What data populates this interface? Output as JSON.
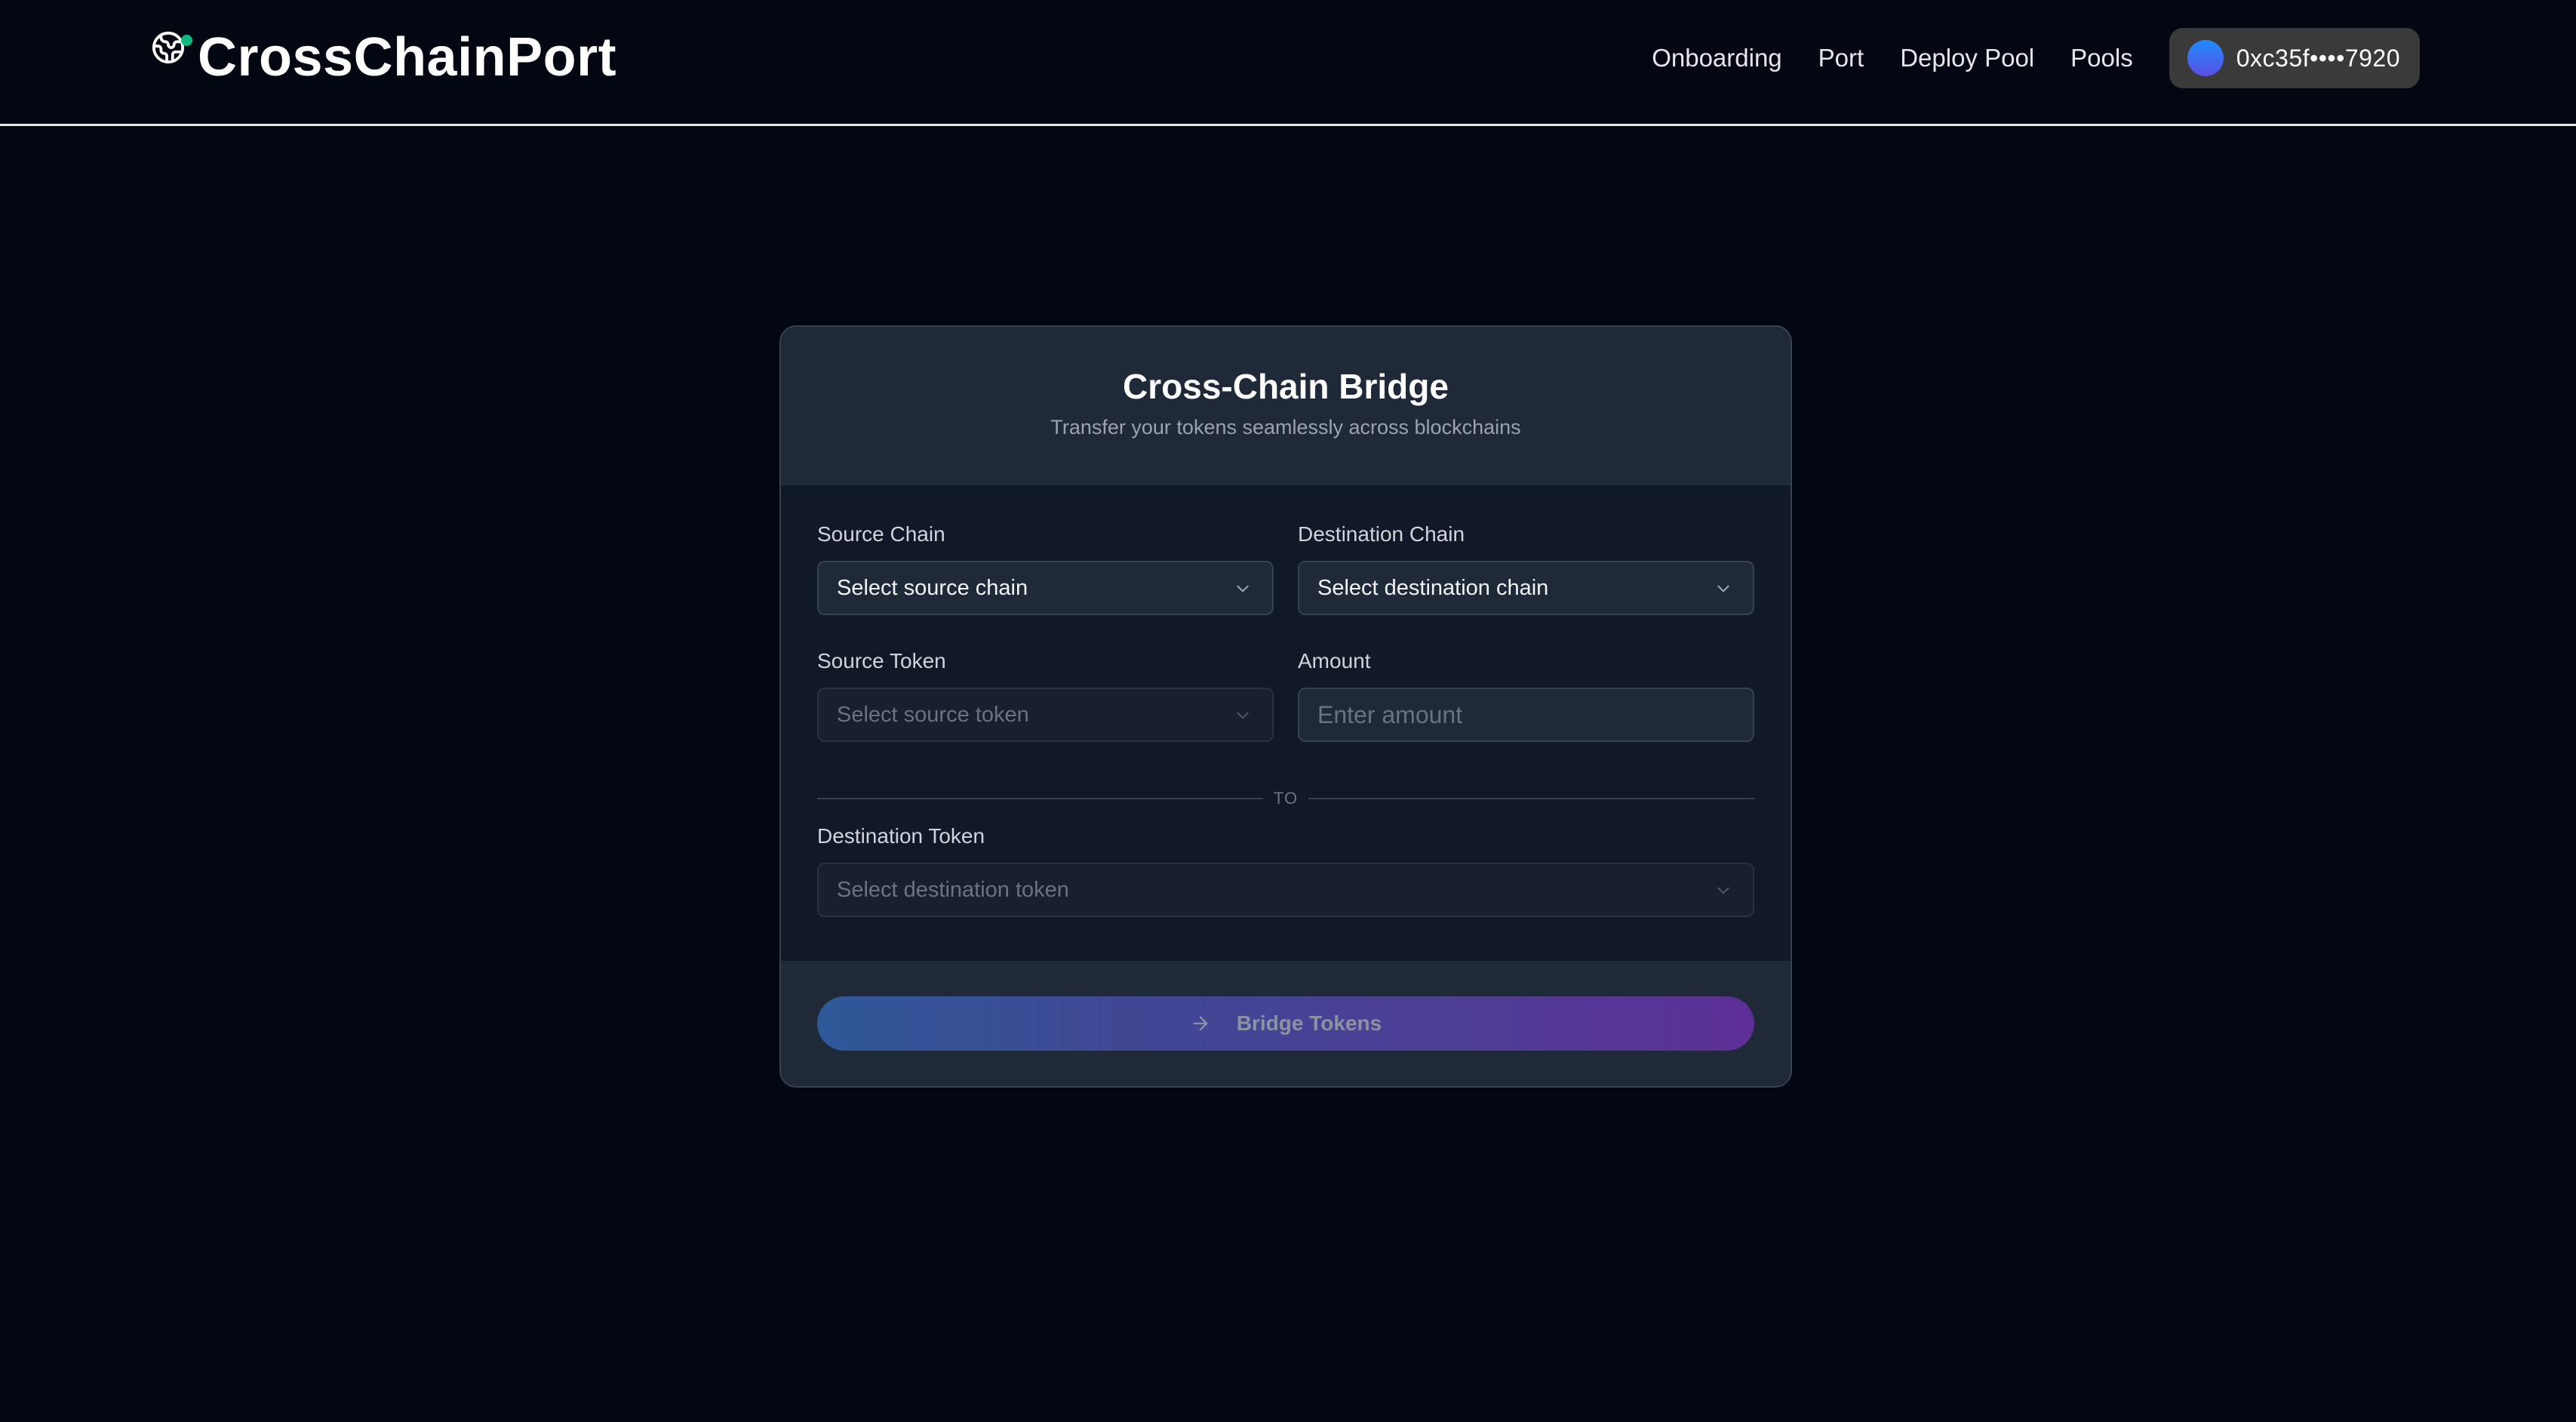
{
  "header": {
    "brand": "CrossChainPort",
    "brand_icon": "globe-icon",
    "brand_status_color": "#10b981",
    "nav": [
      {
        "label": "Onboarding"
      },
      {
        "label": "Port"
      },
      {
        "label": "Deploy Pool"
      },
      {
        "label": "Pools"
      }
    ],
    "wallet": {
      "address": "0xc35f••••7920"
    }
  },
  "bridge": {
    "title": "Cross-Chain Bridge",
    "subtitle": "Transfer your tokens seamlessly across blockchains",
    "source_chain": {
      "label": "Source Chain",
      "value": "Select source chain"
    },
    "destination_chain": {
      "label": "Destination Chain",
      "value": "Select destination chain"
    },
    "source_token": {
      "label": "Source Token",
      "value": "Select source token",
      "disabled": true
    },
    "amount": {
      "label": "Amount",
      "placeholder": "Enter amount",
      "value": ""
    },
    "divider_text": "TO",
    "destination_token": {
      "label": "Destination Token",
      "value": "Select destination token",
      "disabled": true
    },
    "submit": {
      "label": "Bridge Tokens",
      "icon": "arrow-right-icon",
      "disabled": true
    }
  },
  "colors": {
    "background": "#030712",
    "card": "#111827",
    "card_header": "#1f2937",
    "button_gradient_start": "#2f5899",
    "button_gradient_end": "#5d2f96",
    "wallet_bg": "#3a3a3a"
  }
}
